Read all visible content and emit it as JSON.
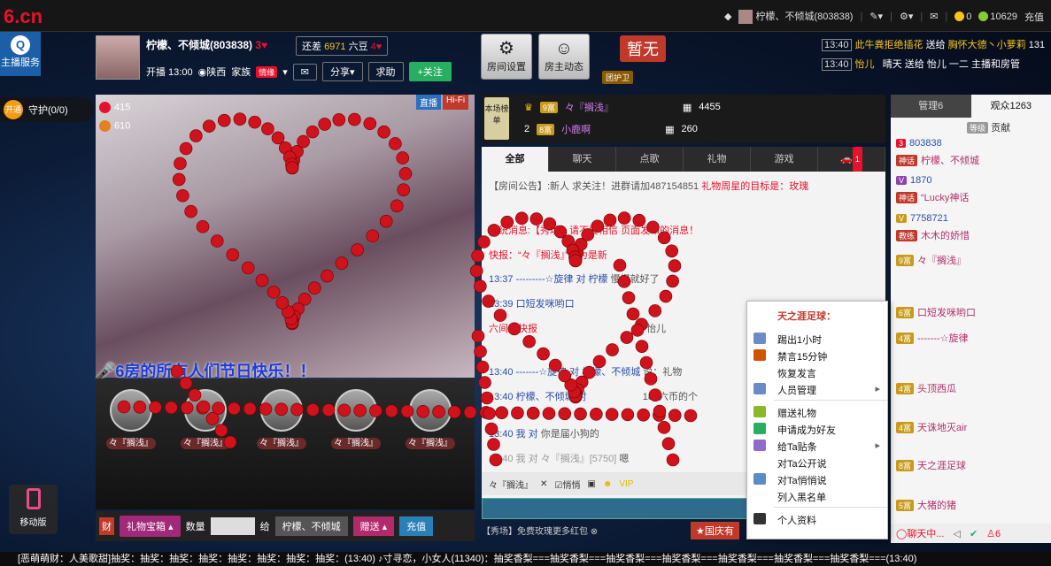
{
  "topbar": {
    "logo": "6.cn",
    "user": "柠檬、不倾城(803838)",
    "coins": "0",
    "beans": "10629",
    "recharge": "充值"
  },
  "sidebar": {
    "host_service": "主播服务",
    "guard_open": "开通",
    "guard_label": "守护(0/0)",
    "mobile": "移动版"
  },
  "host": {
    "name": "柠檬、不倾城(803838)",
    "diff_label": "还差",
    "diff_value": "6971",
    "diff_unit": "六豆",
    "start": "开播 13:00",
    "location": "陕西",
    "family": "家族",
    "family_badge": "情缘",
    "share": "分享",
    "ask": "求助",
    "follow": "+关注"
  },
  "room_buttons": {
    "settings": "房间设置",
    "dynamics": "房主动态",
    "none": "暂无",
    "guard": "团护卫"
  },
  "gift_feed": [
    {
      "time": "13:40",
      "text": "此牛粪拒绝插花",
      "verb": "送给",
      "target": "胸怀大德丶小萝莉",
      "extra": "131"
    },
    {
      "time": "13:40",
      "text": "怡儿",
      "verb": "",
      "target": "晴天 送给 怡儿",
      "extra": "一二 主播和房管"
    }
  ],
  "video": {
    "live": "直播",
    "hifi": "Hi-Fi",
    "stat1": "415",
    "stat2": "610",
    "banner": "6房的所有人们节日快乐！！"
  },
  "seats": [
    "々『搁浅』",
    "々『搁浅』",
    "々『搁浅』",
    "々『搁浅』",
    "々『搁浅』"
  ],
  "controls": {
    "gift_box": "礼物宝箱",
    "qty": "数量",
    "give": "给",
    "recipient": "柠檬、不倾城",
    "send": "赠送",
    "charge": "充值"
  },
  "rank": {
    "badge": "本场榜单",
    "rows": [
      {
        "pos": "1",
        "lvl": "9富",
        "name": "々『搁浅』",
        "value": "4455"
      },
      {
        "pos": "2",
        "lvl": "8富",
        "name": "小鹿啊",
        "value": "260"
      }
    ]
  },
  "chat_tabs": [
    "全部",
    "聊天",
    "点歌",
    "礼物",
    "游戏",
    "1"
  ],
  "chat_lines": [
    {
      "a": "【房间公告】:新人 求关注！进群请加487154851",
      "b": "礼物周星的目标是：玫瑰"
    },
    {
      "a": "系统消息:【秀场】请不要相信",
      "b": "页面发布的消息！"
    },
    {
      "a": "快报：“々『搁浅』”成为是新",
      "b": ""
    },
    {
      "a": "13:37  ---------☆旋律 对 柠檬",
      "b": "慢慢就好了"
    },
    {
      "a": "13:39  口短发咪哟口",
      "b": ""
    },
    {
      "a": "六间房快报",
      "b": "怡儿"
    },
    {
      "a": "13:40  -------☆旋律 对 柠檬、不倾城",
      "b": "说：礼物"
    },
    {
      "a": "13:40  柠檬、不倾城 对",
      "b": "185六币的个"
    },
    {
      "a": "13:40  我 对",
      "b": "你是届小狗的"
    },
    {
      "a": "13:40  我 对 々『搁浅』[5750]",
      "b": "嗯"
    }
  ],
  "chat_tool": {
    "target": "々『搁浅』",
    "whisper": "悄悄"
  },
  "chat_foot": "【秀场】免费玫瑰更多红包",
  "national": "国庆有",
  "context_menu": {
    "title": "天之涯足球：",
    "items": [
      "踢出1小时",
      "禁言15分钟",
      "恢复发言",
      "人员管理",
      "赠送礼物",
      "申请成为好友",
      "给Ta贴条",
      "对Ta公开说",
      "对Ta悄悄说",
      "列入黑名单",
      "个人资料"
    ]
  },
  "audience": {
    "tab_admin": "管理6",
    "tab_viewers": "观众1263",
    "contrib_lvl": "等级",
    "contrib": "贡献",
    "rows": [
      {
        "tag": "3",
        "text": "803838"
      },
      {
        "tag": "神话",
        "text": "柠檬、不倾城"
      },
      {
        "tag": "V",
        "text": "1870"
      },
      {
        "tag": "神话",
        "text": "“Lucky神话"
      },
      {
        "tag": "V",
        "text": "7758721"
      },
      {
        "tag": "教练",
        "text": "木木的娇惜"
      },
      {
        "tag": "9富",
        "text": "々『搁浅』"
      },
      {
        "tag": "6富",
        "text": "口短发咪哟口"
      },
      {
        "tag": "4富",
        "text": "-------☆旋律"
      },
      {
        "tag": "4富",
        "text": "头顶西瓜"
      },
      {
        "tag": "4富",
        "text": "天诛地灭air"
      },
      {
        "tag": "8富",
        "text": "天之涯足球"
      },
      {
        "tag": "5富",
        "text": "大猪的猪"
      }
    ],
    "chat_btn": "聊天中...",
    "count": "6"
  },
  "ticker": "[恶萌萌财：人美歌甜]抽奖：抽奖：抽奖：抽奖：抽奖：抽奖：抽奖：抽奖：(13:40)   ♪寸寻恋，小女人(11340)：抽奖香梨===抽奖香梨===抽奖香梨===抽奖香梨===抽奖香梨===抽奖香梨===抽奖香梨===(13:40)"
}
